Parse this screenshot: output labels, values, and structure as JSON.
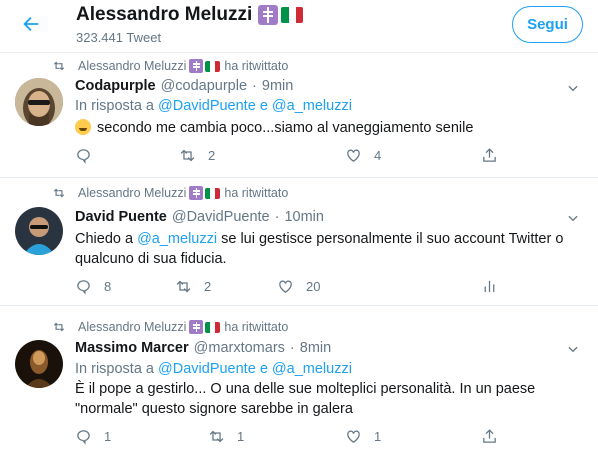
{
  "header": {
    "title": "Alessandro Meluzzi",
    "tweet_count": "323.441 Tweet",
    "follow_label": "Segui"
  },
  "colors": {
    "accent": "#1da1f2",
    "text": "#14171a",
    "muted": "#657786",
    "border": "#e6ecf0"
  },
  "icons": [
    "back-arrow-icon",
    "orthodox-cross-emoji",
    "italy-flag-emoji",
    "retweet-icon",
    "chevron-down-icon",
    "reply-icon",
    "like-icon",
    "share-icon",
    "analytics-icon",
    "laughing-emoji"
  ],
  "tweets": [
    {
      "retweeter": "Alessandro Meluzzi",
      "retweet_text": "ha ritwittato",
      "name": "Codapurple",
      "handle": "@codapurple",
      "dot": "·",
      "time": "9min",
      "reply_prefix": "In risposta a",
      "reply_user1": "@DavidPuente",
      "reply_and": "e",
      "reply_user2": "@a_meluzzi",
      "text": "secondo me cambia poco...siamo al vaneggiamento senile",
      "replies": "",
      "retweets": "2",
      "likes": "4"
    },
    {
      "retweeter": "Alessandro Meluzzi",
      "retweet_text": "ha ritwittato",
      "name": "David Puente",
      "handle": "@DavidPuente",
      "dot": "·",
      "time": "10min",
      "text_prefix": "Chiedo a",
      "text_mention": "@a_meluzzi",
      "text_rest": "se lui gestisce personalmente il suo account Twitter o qualcuno di sua fiducia.",
      "replies": "8",
      "retweets": "2",
      "likes": "20"
    },
    {
      "retweeter": "Alessandro Meluzzi",
      "retweet_text": "ha ritwittato",
      "name": "Massimo Marcer",
      "handle": "@marxtomars",
      "dot": "·",
      "time": "8min",
      "reply_prefix": "In risposta a",
      "reply_user1": "@DavidPuente",
      "reply_and": "e",
      "reply_user2": "@a_meluzzi",
      "text": "È il pope a gestirlo... O una delle sue molteplici personalità. In un paese \"normale\" questo signore sarebbe in galera",
      "replies": "1",
      "retweets": "1",
      "likes": "1"
    }
  ]
}
